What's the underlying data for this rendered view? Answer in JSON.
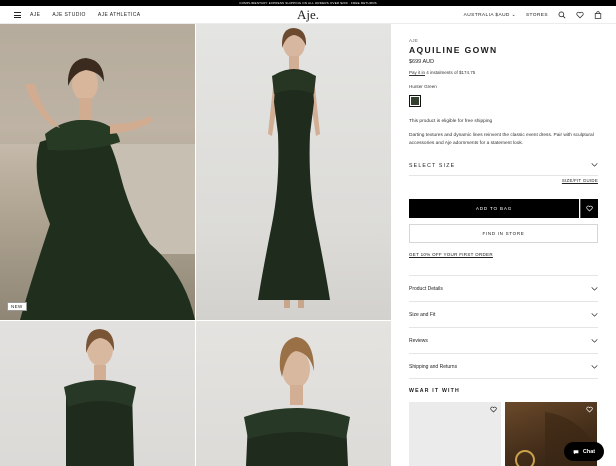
{
  "promo": {
    "text": "COMPLIMENTARY EXPRESS SHIPPING ON ALL ORDERS OVER $200 · FREE RETURNS"
  },
  "header": {
    "nav_left": [
      "AJE",
      "AJE STUDIO",
      "AJE ATHLETICA"
    ],
    "logo": "Aje.",
    "region": "AUSTRALIA $AUD",
    "stores": "STORES",
    "icons": [
      "menu-icon",
      "search-icon",
      "heart-icon",
      "bag-icon"
    ]
  },
  "gallery": {
    "badge": "NEW"
  },
  "product": {
    "brand": "AJE",
    "title": "AQUILINE GOWN",
    "price": "$699 AUD",
    "afterpay_link": "Pay it in",
    "afterpay_text": " 4 instalments of $174.75",
    "colour": "Hunter Green",
    "colour_hex": "#33412e",
    "shipping": "This product is eligible for free shipping",
    "description": "Darting textures and dynamic lines reinvent the classic event dress. Pair with sculptural accessories and Aje adornments for a statement look.",
    "select_size": "SELECT SIZE",
    "size_guide": "SIZE/FIT GUIDE",
    "add_to_bag": "ADD TO BAG",
    "find_in_store": "FIND IN STORE",
    "signup": "GET 10% OFF YOUR FIRST ORDER",
    "accordion": [
      "Product Details",
      "Size and Fit",
      "Reviews",
      "Shipping and Returns"
    ],
    "wear_it_with": "WEAR IT WITH"
  },
  "chat": {
    "label": "Chat"
  }
}
